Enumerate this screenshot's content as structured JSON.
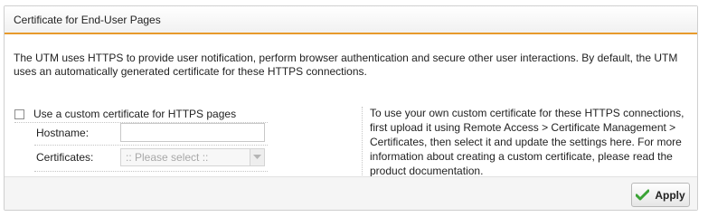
{
  "panel": {
    "title": "Certificate for End-User Pages",
    "accent_color": "#e79a2c"
  },
  "description_line1": "The UTM uses HTTPS to provide user notification, perform browser authentication and secure other user interactions. By default, the UTM",
  "description_line2": "uses an automatically generated certificate for these HTTPS connections.",
  "custom_cert": {
    "checkbox_label": "Use a custom certificate for HTTPS pages",
    "checked": false
  },
  "hostname": {
    "label": "Hostname:",
    "value": ""
  },
  "certificates": {
    "label": "Certificates:",
    "placeholder": ":: Please select ::"
  },
  "help": {
    "lines": [
      "To use your own custom certificate for these HTTPS connections,",
      "first upload it using Remote Access > Certificate Management >",
      "Certificates, then select it and update the settings here. For more",
      "information about creating a custom certificate, please read the",
      "product documentation."
    ]
  },
  "actions": {
    "apply_label": "Apply",
    "apply_icon": "check-icon",
    "apply_icon_color": "#3aa335"
  }
}
